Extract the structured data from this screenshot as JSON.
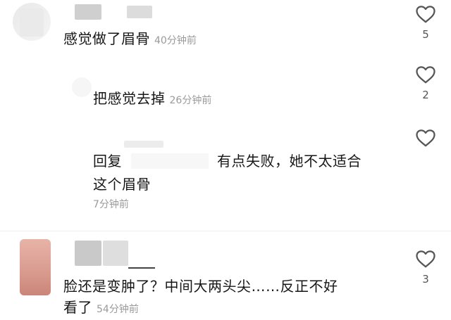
{
  "comments": [
    {
      "text": "感觉做了眉骨",
      "time": "40分钟前",
      "likes": "5"
    },
    {
      "text": "把感觉去掉",
      "time": "26分钟前",
      "likes": "2"
    },
    {
      "reply_prefix": "回复",
      "text_line1": "有点失败，她不太适合",
      "text_line2": "这个眉骨",
      "time": "7分钟前"
    },
    {
      "text_line1": "脸还是变肿了？中间大两头尖……反正不好",
      "text_line2": "看了",
      "time": "54分钟前",
      "likes": "3"
    }
  ],
  "icons": {
    "like": "heart-outline-icon"
  },
  "colors": {
    "text": "#161616",
    "muted": "#9a9a9a",
    "icon": "#555555"
  }
}
